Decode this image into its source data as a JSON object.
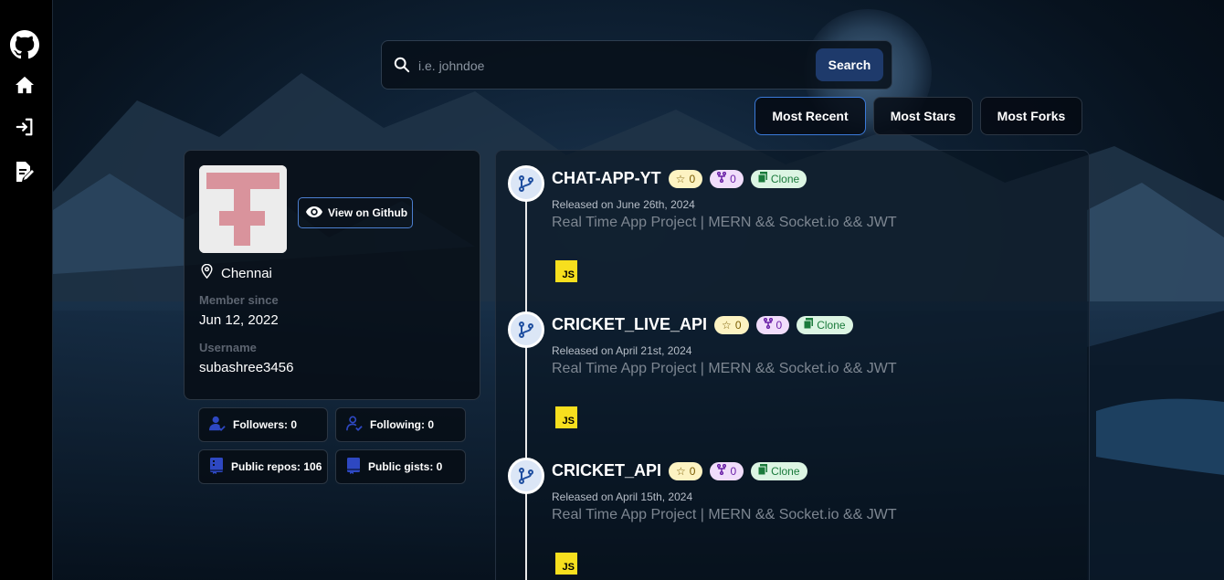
{
  "sidebar": {
    "items": [
      {
        "icon": "github-icon"
      },
      {
        "icon": "home-icon"
      },
      {
        "icon": "login-icon"
      },
      {
        "icon": "signup-icon"
      }
    ]
  },
  "search": {
    "placeholder": "i.e. johndoe",
    "value": "",
    "button_label": "Search"
  },
  "sort": {
    "most_recent": "Most Recent",
    "most_stars": "Most Stars",
    "most_forks": "Most Forks",
    "active": "Most Recent"
  },
  "profile": {
    "view_label": "View on Github",
    "location": "Chennai",
    "member_since_label": "Member since",
    "member_since": "Jun 12, 2022",
    "username_label": "Username",
    "username": "subashree3456"
  },
  "stats": {
    "followers": "Followers: 0",
    "following": "Following: 0",
    "public_repos": "Public repos: 106",
    "public_gists": "Public gists: 0"
  },
  "repos": [
    {
      "name": "CHAT-APP-YT",
      "stars": "0",
      "forks": "0",
      "clone_label": "Clone",
      "released": "Released on June 26th, 2024",
      "description": "Real Time App Project | MERN && Socket.io && JWT",
      "language": "JS"
    },
    {
      "name": "CRICKET_LIVE_API",
      "stars": "0",
      "forks": "0",
      "clone_label": "Clone",
      "released": "Released on April 21st, 2024",
      "description": "Real Time App Project | MERN && Socket.io && JWT",
      "language": "JS"
    },
    {
      "name": "CRICKET_API",
      "stars": "0",
      "forks": "0",
      "clone_label": "Clone",
      "released": "Released on April 15th, 2024",
      "description": "Real Time App Project | MERN && Socket.io && JWT",
      "language": "JS"
    }
  ],
  "colors": {
    "accent": "#1e3a6b",
    "active_border": "#3a79d8",
    "star_pill": "#fdf3c2",
    "fork_pill": "#f1ddfb",
    "clone_pill": "#dcf5e3",
    "js_badge": "#f7df1e"
  }
}
